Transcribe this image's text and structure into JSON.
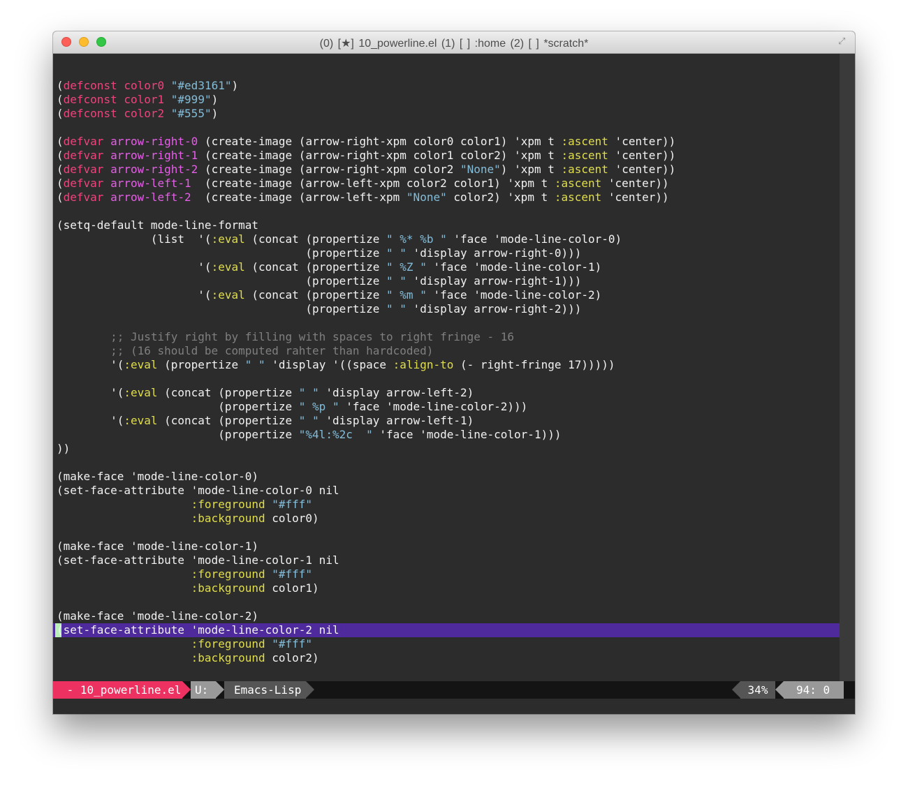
{
  "window": {
    "title": "(0) [★] 10_powerline.el    (1) [  ] :home    (2) [ ] *scratch*",
    "fullscreen_icon": "fullscreen-arrows-icon"
  },
  "editor": {
    "lines": [
      {
        "text": "",
        "tokens": []
      },
      {
        "text": "(defconst color0 \"#ed3161\")",
        "tokens": [
          [
            "(",
            ""
          ],
          [
            "defconst",
            "kw"
          ],
          [
            " ",
            ""
          ],
          [
            "color0",
            "kw"
          ],
          [
            " ",
            ""
          ],
          [
            "\"#ed3161\"",
            "str"
          ],
          [
            ")",
            ""
          ]
        ]
      },
      {
        "text": "(defconst color1 \"#999\")",
        "tokens": [
          [
            "(",
            ""
          ],
          [
            "defconst",
            "kw"
          ],
          [
            " ",
            ""
          ],
          [
            "color1",
            "kw"
          ],
          [
            " ",
            ""
          ],
          [
            "\"#999\"",
            "str"
          ],
          [
            ")",
            ""
          ]
        ]
      },
      {
        "text": "(defconst color2 \"#555\")",
        "tokens": [
          [
            "(",
            ""
          ],
          [
            "defconst",
            "kw"
          ],
          [
            " ",
            ""
          ],
          [
            "color2",
            "kw"
          ],
          [
            " ",
            ""
          ],
          [
            "\"#555\"",
            "str"
          ],
          [
            ")",
            ""
          ]
        ]
      },
      {
        "text": "",
        "tokens": []
      },
      {
        "text": "(defvar arrow-right-0 (create-image (arrow-right-xpm color0 color1) 'xpm t :ascent 'center))",
        "tokens": [
          [
            "(",
            ""
          ],
          [
            "defvar",
            "kw"
          ],
          [
            " ",
            ""
          ],
          [
            "arrow-right-0",
            "fn"
          ],
          [
            " (create-image (arrow-right-xpm color0 color1) 'xpm t ",
            ""
          ],
          [
            ":ascent",
            "kwd"
          ],
          [
            " 'center))",
            ""
          ]
        ]
      },
      {
        "text": "(defvar arrow-right-1 (create-image (arrow-right-xpm color1 color2) 'xpm t :ascent 'center))",
        "tokens": [
          [
            "(",
            ""
          ],
          [
            "defvar",
            "kw"
          ],
          [
            " ",
            ""
          ],
          [
            "arrow-right-1",
            "fn"
          ],
          [
            " (create-image (arrow-right-xpm color1 color2) 'xpm t ",
            ""
          ],
          [
            ":ascent",
            "kwd"
          ],
          [
            " 'center))",
            ""
          ]
        ]
      },
      {
        "text": "(defvar arrow-right-2 (create-image (arrow-right-xpm color2 \"None\") 'xpm t :ascent 'center))",
        "tokens": [
          [
            "(",
            ""
          ],
          [
            "defvar",
            "kw"
          ],
          [
            " ",
            ""
          ],
          [
            "arrow-right-2",
            "fn"
          ],
          [
            " (create-image (arrow-right-xpm color2 ",
            ""
          ],
          [
            "\"None\"",
            "str"
          ],
          [
            ") 'xpm t ",
            ""
          ],
          [
            ":ascent",
            "kwd"
          ],
          [
            " 'center))",
            ""
          ]
        ]
      },
      {
        "text": "(defvar arrow-left-1  (create-image (arrow-left-xpm color2 color1) 'xpm t :ascent 'center))",
        "tokens": [
          [
            "(",
            ""
          ],
          [
            "defvar",
            "kw"
          ],
          [
            " ",
            ""
          ],
          [
            "arrow-left-1",
            "fn"
          ],
          [
            "  (create-image (arrow-left-xpm color2 color1) 'xpm t ",
            ""
          ],
          [
            ":ascent",
            "kwd"
          ],
          [
            " 'center))",
            ""
          ]
        ]
      },
      {
        "text": "(defvar arrow-left-2  (create-image (arrow-left-xpm \"None\" color2) 'xpm t :ascent 'center))",
        "tokens": [
          [
            "(",
            ""
          ],
          [
            "defvar",
            "kw"
          ],
          [
            " ",
            ""
          ],
          [
            "arrow-left-2",
            "fn"
          ],
          [
            "  (create-image (arrow-left-xpm ",
            ""
          ],
          [
            "\"None\"",
            "str"
          ],
          [
            " color2) 'xpm t ",
            ""
          ],
          [
            ":ascent",
            "kwd"
          ],
          [
            " 'center))",
            ""
          ]
        ]
      },
      {
        "text": "",
        "tokens": []
      },
      {
        "text": "(setq-default mode-line-format",
        "tokens": [
          [
            "(setq-default mode-line-format",
            ""
          ]
        ]
      },
      {
        "text": "              (list  '(:eval (concat (propertize \" %* %b \" 'face 'mode-line-color-0)",
        "tokens": [
          [
            "              (list  '(",
            ""
          ],
          [
            ":eval",
            "kwd"
          ],
          [
            " (concat (propertize ",
            ""
          ],
          [
            "\" %* %b \"",
            "str"
          ],
          [
            " 'face 'mode-line-color-0)",
            ""
          ]
        ]
      },
      {
        "text": "                                     (propertize \" \" 'display arrow-right-0)))",
        "tokens": [
          [
            "                                     (propertize ",
            ""
          ],
          [
            "\" \"",
            "str"
          ],
          [
            " 'display arrow-right-0)))",
            ""
          ]
        ]
      },
      {
        "text": "                     '(:eval (concat (propertize \" %Z \" 'face 'mode-line-color-1)",
        "tokens": [
          [
            "                     '(",
            ""
          ],
          [
            ":eval",
            "kwd"
          ],
          [
            " (concat (propertize ",
            ""
          ],
          [
            "\" %Z \"",
            "str"
          ],
          [
            " 'face 'mode-line-color-1)",
            ""
          ]
        ]
      },
      {
        "text": "                                     (propertize \" \" 'display arrow-right-1)))",
        "tokens": [
          [
            "                                     (propertize ",
            ""
          ],
          [
            "\" \"",
            "str"
          ],
          [
            " 'display arrow-right-1)))",
            ""
          ]
        ]
      },
      {
        "text": "                     '(:eval (concat (propertize \" %m \" 'face 'mode-line-color-2)",
        "tokens": [
          [
            "                     '(",
            ""
          ],
          [
            ":eval",
            "kwd"
          ],
          [
            " (concat (propertize ",
            ""
          ],
          [
            "\" %m \"",
            "str"
          ],
          [
            " 'face 'mode-line-color-2)",
            ""
          ]
        ]
      },
      {
        "text": "                                     (propertize \" \" 'display arrow-right-2)))",
        "tokens": [
          [
            "                                     (propertize ",
            ""
          ],
          [
            "\" \"",
            "str"
          ],
          [
            " 'display arrow-right-2)))",
            ""
          ]
        ]
      },
      {
        "text": "",
        "tokens": []
      },
      {
        "text": "        ;; Justify right by filling with spaces to right fringe - 16",
        "tokens": [
          [
            "        ",
            ""
          ],
          [
            ";; Justify right by filling with spaces to right fringe - 16",
            "cmt"
          ]
        ]
      },
      {
        "text": "        ;; (16 should be computed rahter than hardcoded)",
        "tokens": [
          [
            "        ",
            ""
          ],
          [
            ";; (16 should be computed rahter than hardcoded)",
            "cmt"
          ]
        ]
      },
      {
        "text": "        '(:eval (propertize \" \" 'display '((space :align-to (- right-fringe 17)))))",
        "tokens": [
          [
            "        '(",
            ""
          ],
          [
            ":eval",
            "kwd"
          ],
          [
            " (propertize ",
            ""
          ],
          [
            "\" \"",
            "str"
          ],
          [
            " 'display '((space ",
            ""
          ],
          [
            ":align-to",
            "kwd"
          ],
          [
            " (- right-fringe 17)))))",
            ""
          ]
        ]
      },
      {
        "text": "",
        "tokens": []
      },
      {
        "text": "        '(:eval (concat (propertize \" \" 'display arrow-left-2)",
        "tokens": [
          [
            "        '(",
            ""
          ],
          [
            ":eval",
            "kwd"
          ],
          [
            " (concat (propertize ",
            ""
          ],
          [
            "\" \"",
            "str"
          ],
          [
            " 'display arrow-left-2)",
            ""
          ]
        ]
      },
      {
        "text": "                        (propertize \" %p \" 'face 'mode-line-color-2)))",
        "tokens": [
          [
            "                        (propertize ",
            ""
          ],
          [
            "\" %p \"",
            "str"
          ],
          [
            " 'face 'mode-line-color-2)))",
            ""
          ]
        ]
      },
      {
        "text": "        '(:eval (concat (propertize \" \" 'display arrow-left-1)",
        "tokens": [
          [
            "        '(",
            ""
          ],
          [
            ":eval",
            "kwd"
          ],
          [
            " (concat (propertize ",
            ""
          ],
          [
            "\" \"",
            "str"
          ],
          [
            " 'display arrow-left-1)",
            ""
          ]
        ]
      },
      {
        "text": "                        (propertize \"%4l:%2c  \" 'face 'mode-line-color-1)))",
        "tokens": [
          [
            "                        (propertize ",
            ""
          ],
          [
            "\"%4l:%2c  \"",
            "str"
          ],
          [
            " 'face 'mode-line-color-1)))",
            ""
          ]
        ]
      },
      {
        "text": "))",
        "tokens": [
          [
            "))",
            ""
          ]
        ]
      },
      {
        "text": "",
        "tokens": []
      },
      {
        "text": "(make-face 'mode-line-color-0)",
        "tokens": [
          [
            "(make-face 'mode-line-color-0)",
            ""
          ]
        ]
      },
      {
        "text": "(set-face-attribute 'mode-line-color-0 nil",
        "tokens": [
          [
            "(set-face-attribute 'mode-line-color-0 nil",
            ""
          ]
        ]
      },
      {
        "text": "                    :foreground \"#fff\"",
        "tokens": [
          [
            "                    ",
            ""
          ],
          [
            ":foreground",
            "kwd"
          ],
          [
            " ",
            ""
          ],
          [
            "\"#fff\"",
            "str"
          ]
        ]
      },
      {
        "text": "                    :background color0)",
        "tokens": [
          [
            "                    ",
            ""
          ],
          [
            ":background",
            "kwd"
          ],
          [
            " color0)",
            ""
          ]
        ]
      },
      {
        "text": "",
        "tokens": []
      },
      {
        "text": "(make-face 'mode-line-color-1)",
        "tokens": [
          [
            "(make-face 'mode-line-color-1)",
            ""
          ]
        ]
      },
      {
        "text": "(set-face-attribute 'mode-line-color-1 nil",
        "tokens": [
          [
            "(set-face-attribute 'mode-line-color-1 nil",
            ""
          ]
        ]
      },
      {
        "text": "                    :foreground \"#fff\"",
        "tokens": [
          [
            "                    ",
            ""
          ],
          [
            ":foreground",
            "kwd"
          ],
          [
            " ",
            ""
          ],
          [
            "\"#fff\"",
            "str"
          ]
        ]
      },
      {
        "text": "                    :background color1)",
        "tokens": [
          [
            "                    ",
            ""
          ],
          [
            ":background",
            "kwd"
          ],
          [
            " color1)",
            ""
          ]
        ]
      },
      {
        "text": "",
        "tokens": []
      },
      {
        "text": "(make-face 'mode-line-color-2)",
        "tokens": [
          [
            "(make-face 'mode-line-color-2)",
            ""
          ]
        ]
      },
      {
        "text": "(set-face-attribute 'mode-line-color-2 nil",
        "tokens": [
          [
            "(set-face-attribute 'mode-line-color-2 nil",
            ""
          ]
        ]
      },
      {
        "text": "                    :foreground \"#fff\"",
        "tokens": [
          [
            "                    ",
            ""
          ],
          [
            ":foreground",
            "kwd"
          ],
          [
            " ",
            ""
          ],
          [
            "\"#fff\"",
            "str"
          ]
        ]
      },
      {
        "text": "                    :background color2)",
        "tokens": [
          [
            "                    ",
            ""
          ],
          [
            ":background",
            "kwd"
          ],
          [
            " color2)",
            ""
          ]
        ]
      }
    ],
    "current_line_color": "#4e2a9c",
    "cursor_color": "#b8f0b8"
  },
  "modeline": {
    "buffer": " - 10_powerline.el",
    "state": "U:",
    "mode": "Emacs-Lisp",
    "percent": "34%",
    "position": "94: 0",
    "colors": {
      "color0": "#ed3161",
      "color1": "#999",
      "color2": "#555"
    }
  }
}
